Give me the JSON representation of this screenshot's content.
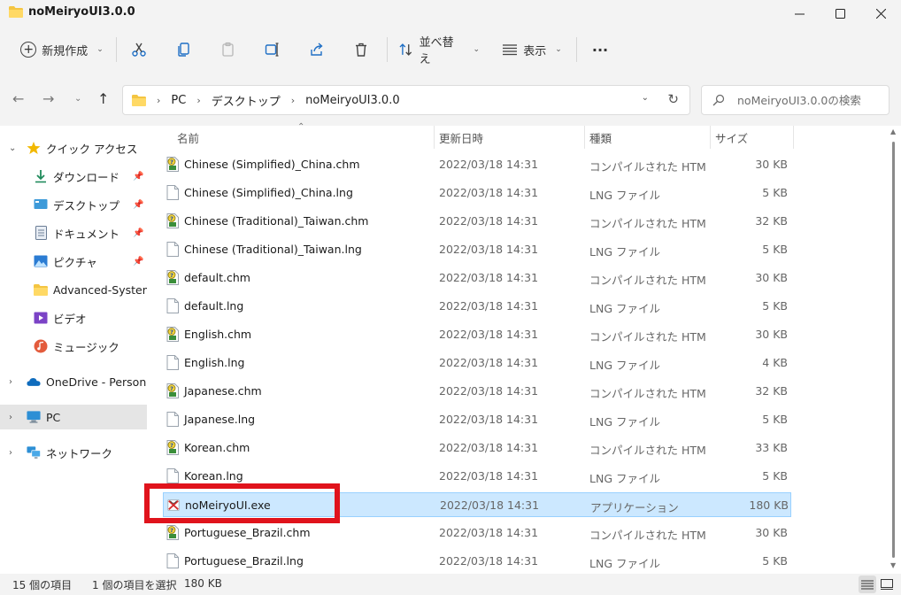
{
  "window": {
    "title": "noMeiryoUI3.0.0"
  },
  "toolbar": {
    "new_label": "新規作成",
    "sort_label": "並べ替え",
    "view_label": "表示",
    "more_label": "···"
  },
  "address": {
    "crumbs": [
      "PC",
      "デスクトップ",
      "noMeiryoUI3.0.0"
    ]
  },
  "search": {
    "placeholder": "noMeiryoUI3.0.0の検索"
  },
  "sidebar": {
    "items": [
      {
        "label": "クイック アクセス"
      },
      {
        "label": "ダウンロード"
      },
      {
        "label": "デスクトップ"
      },
      {
        "label": "ドキュメント"
      },
      {
        "label": "ピクチャ"
      },
      {
        "label": "Advanced-System-"
      },
      {
        "label": "ビデオ"
      },
      {
        "label": "ミュージック"
      },
      {
        "label": "OneDrive - Persona"
      },
      {
        "label": "PC"
      },
      {
        "label": "ネットワーク"
      }
    ]
  },
  "columns": {
    "name": "名前",
    "date": "更新日時",
    "type": "種類",
    "size": "サイズ"
  },
  "files": [
    {
      "name": "Chinese (Simplified)_China.chm",
      "date": "2022/03/18 14:31",
      "type": "コンパイルされた HTML...",
      "size": "30 KB",
      "icon": "chm-help-icon"
    },
    {
      "name": "Chinese (Simplified)_China.lng",
      "date": "2022/03/18 14:31",
      "type": "LNG ファイル",
      "size": "5 KB",
      "icon": "blank-file-icon"
    },
    {
      "name": "Chinese (Traditional)_Taiwan.chm",
      "date": "2022/03/18 14:31",
      "type": "コンパイルされた HTML...",
      "size": "32 KB",
      "icon": "chm-help-icon"
    },
    {
      "name": "Chinese (Traditional)_Taiwan.lng",
      "date": "2022/03/18 14:31",
      "type": "LNG ファイル",
      "size": "5 KB",
      "icon": "blank-file-icon"
    },
    {
      "name": "default.chm",
      "date": "2022/03/18 14:31",
      "type": "コンパイルされた HTML...",
      "size": "30 KB",
      "icon": "chm-help-icon"
    },
    {
      "name": "default.lng",
      "date": "2022/03/18 14:31",
      "type": "LNG ファイル",
      "size": "5 KB",
      "icon": "blank-file-icon"
    },
    {
      "name": "English.chm",
      "date": "2022/03/18 14:31",
      "type": "コンパイルされた HTML...",
      "size": "30 KB",
      "icon": "chm-help-icon"
    },
    {
      "name": "English.lng",
      "date": "2022/03/18 14:31",
      "type": "LNG ファイル",
      "size": "4 KB",
      "icon": "blank-file-icon"
    },
    {
      "name": "Japanese.chm",
      "date": "2022/03/18 14:31",
      "type": "コンパイルされた HTML...",
      "size": "32 KB",
      "icon": "chm-help-icon"
    },
    {
      "name": "Japanese.lng",
      "date": "2022/03/18 14:31",
      "type": "LNG ファイル",
      "size": "5 KB",
      "icon": "blank-file-icon"
    },
    {
      "name": "Korean.chm",
      "date": "2022/03/18 14:31",
      "type": "コンパイルされた HTML...",
      "size": "33 KB",
      "icon": "chm-help-icon"
    },
    {
      "name": "Korean.lng",
      "date": "2022/03/18 14:31",
      "type": "LNG ファイル",
      "size": "5 KB",
      "icon": "blank-file-icon"
    },
    {
      "name": "noMeiryoUI.exe",
      "date": "2022/03/18 14:31",
      "type": "アプリケーション",
      "size": "180 KB",
      "icon": "app-exe-icon",
      "selected": true
    },
    {
      "name": "Portuguese_Brazil.chm",
      "date": "2022/03/18 14:31",
      "type": "コンパイルされた HTML...",
      "size": "30 KB",
      "icon": "chm-help-icon"
    },
    {
      "name": "Portuguese_Brazil.lng",
      "date": "2022/03/18 14:31",
      "type": "LNG ファイル",
      "size": "5 KB",
      "icon": "blank-file-icon"
    }
  ],
  "status": {
    "count": "15 個の項目",
    "selection": "1 個の項目を選択",
    "selection_size": "180 KB"
  },
  "colors": {
    "selection_bg": "#cce8ff",
    "selection_border": "#99d1ff",
    "highlight_red": "#e0131c",
    "folder_yellow": "#f4c542"
  }
}
